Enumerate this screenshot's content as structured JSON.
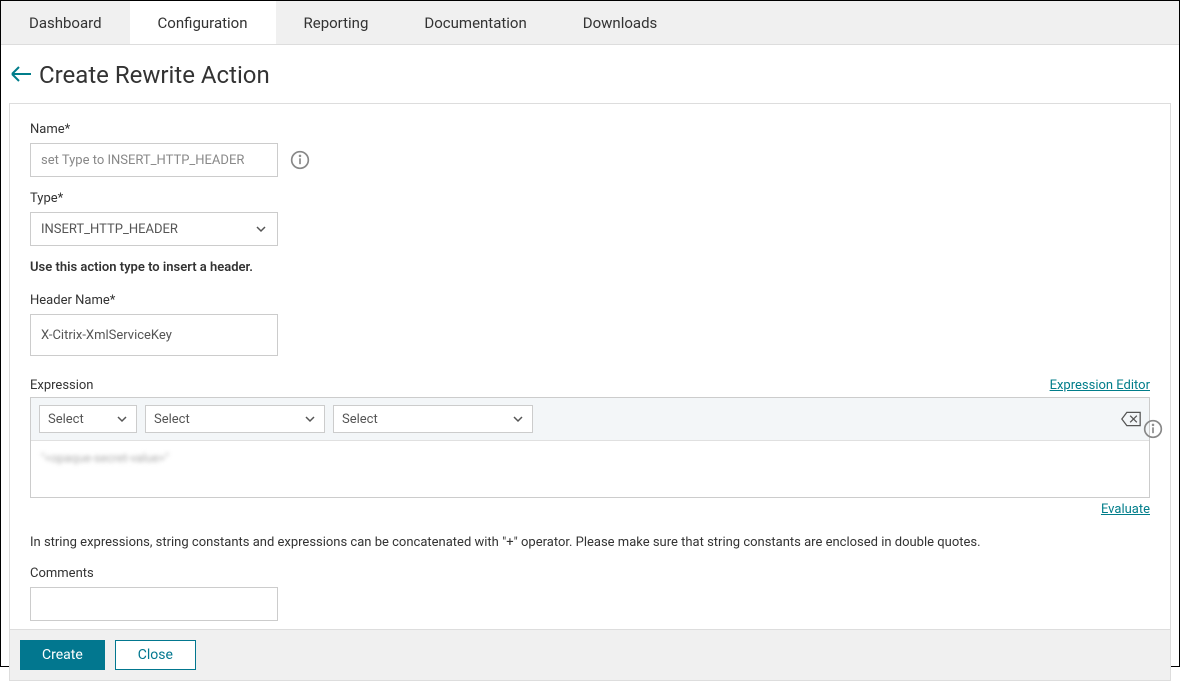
{
  "tabs": {
    "dashboard": "Dashboard",
    "configuration": "Configuration",
    "reporting": "Reporting",
    "documentation": "Documentation",
    "downloads": "Downloads"
  },
  "page": {
    "title": "Create Rewrite Action"
  },
  "form": {
    "name_label": "Name*",
    "name_placeholder": "set Type to INSERT_HTTP_HEADER",
    "type_label": "Type*",
    "type_value": "INSERT_HTTP_HEADER",
    "type_description": "Use this action type to insert a header.",
    "header_name_label": "Header Name*",
    "header_name_value": "X-Citrix-XmlServiceKey",
    "expression_label": "Expression",
    "expression_editor_link": "Expression Editor",
    "expr_select1": "Select",
    "expr_select2": "Select",
    "expr_select3": "Select",
    "expression_value": "\"<opaque-secret-value>\"",
    "evaluate_link": "Evaluate",
    "help_text": "In string expressions, string constants and expressions can be concatenated with \"+\" operator. Please make sure that string constants are enclosed in double quotes.",
    "comments_label": "Comments"
  },
  "buttons": {
    "create": "Create",
    "close": "Close"
  }
}
